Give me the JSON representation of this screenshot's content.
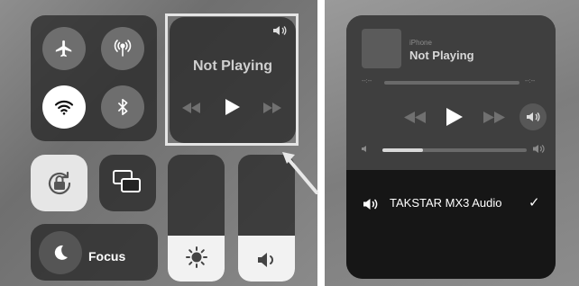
{
  "control_center": {
    "now_playing": {
      "status": "Not Playing"
    },
    "focus": {
      "label": "Focus"
    },
    "brightness": {
      "level": 0.36
    },
    "volume": {
      "level": 0.36
    }
  },
  "expanded_player": {
    "source": "iPhone",
    "status": "Not Playing",
    "elapsed": "--:--",
    "remaining": "--:--",
    "volume_level": 0.28,
    "output_device": "TAKSTAR MX3 Audio",
    "output_selected": "✓"
  },
  "colors": {
    "tile_bg": "#232323",
    "active_white": "#ffffff",
    "inactive_gray": "#6e6e6e"
  }
}
